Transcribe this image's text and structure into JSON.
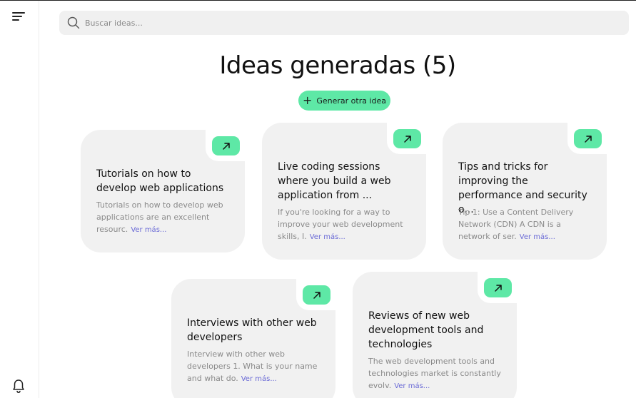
{
  "search": {
    "placeholder": "Buscar ideas..."
  },
  "header": {
    "title": "Ideas generadas (5)"
  },
  "generate_button": {
    "label": "Generar otra idea"
  },
  "more_label": "Ver más...",
  "colors": {
    "accent": "#5ee8a6",
    "card_bg": "#f1f1f1",
    "link": "#6b6bd6"
  },
  "cards": [
    {
      "title": "Tutorials on how to develop web applications",
      "excerpt": "Tutorials on how to develop web applications are an excellent resourc."
    },
    {
      "title": "Live coding sessions where you build a web application from ...",
      "excerpt": "If you're looking for a way to improve your web development skills, I."
    },
    {
      "title": "Tips and tricks for improving the performance and security o...",
      "excerpt": "Tip 1: Use a Content Delivery Network (CDN) A CDN is a network of ser."
    },
    {
      "title": "Interviews with other web developers",
      "excerpt": "Interview with other web developers 1. What is your name and what do."
    },
    {
      "title": "Reviews of new web development tools and technologies",
      "excerpt": "The web development tools and technologies market is constantly evolv."
    }
  ]
}
